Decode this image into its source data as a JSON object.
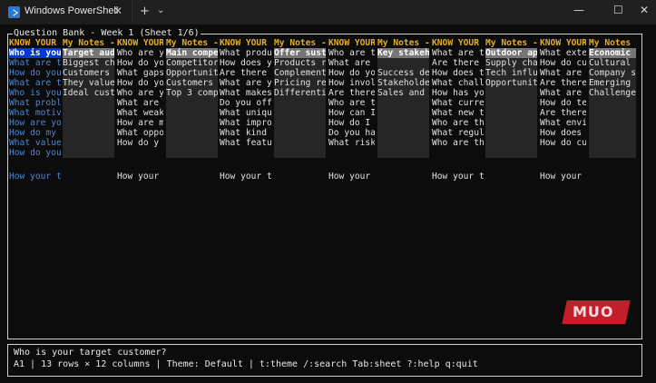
{
  "window": {
    "tab_title": "Windows PowerShell",
    "tab_close": "✕",
    "new_tab": "+",
    "dropdown": "⌄",
    "minimize": "—",
    "maximize": "☐",
    "close": "✕"
  },
  "panel": {
    "title": "Question Bank - Week 1 (Sheet 1/6)"
  },
  "sheet": {
    "headers": [
      "KNOW YOUR",
      "My Notes -",
      "KNOW YOUR",
      "My Notes -",
      "KNOW YOUR",
      "My Notes -",
      "KNOW YOUR",
      "My Notes -",
      "KNOW YOUR",
      "My Notes -",
      "KNOW YOUR",
      "My Notes -"
    ],
    "rows": [
      [
        "Who is you",
        "Target aud",
        "Who are y",
        "Main compe",
        "What produ",
        "Offer sust",
        "Who are t",
        "Key stakeh",
        "What are t",
        "Outdoor ap",
        "What exte",
        "Economic s"
      ],
      [
        "What are t",
        "Biggest ch",
        "How do yo",
        "Competitor",
        "How does y",
        "Products r",
        "What are",
        "",
        "Are there",
        "Supply cha",
        "How do cu",
        "Cultural t"
      ],
      [
        "How do you",
        "Customers",
        "What gaps",
        "Opportunit",
        "Are there",
        "Complement",
        "How do yo",
        "Success de",
        "How does t",
        "Tech influ",
        "What are",
        "Company st"
      ],
      [
        "What are t",
        "They value",
        "How do yo",
        "Customers",
        "What are y",
        "Pricing re",
        "How invol",
        "Stakeholde",
        "What chall",
        "Opportunit",
        "Are there",
        "Emerging m"
      ],
      [
        "Who is you",
        "Ideal cust",
        "Who are y",
        "Top 3 comp",
        "What makes",
        "Differenti",
        "Are there",
        "Sales and",
        "How has yo",
        "",
        "What are",
        "Challenges"
      ],
      [
        "What probl",
        "",
        "What are",
        "",
        "Do you off",
        "",
        "Who are t",
        "",
        "What curre",
        "",
        "How do te",
        ""
      ],
      [
        "What motiv",
        "",
        "What weak",
        "",
        "What uniqu",
        "",
        "How can I",
        "",
        "What new t",
        "",
        "Are there",
        ""
      ],
      [
        "How are yo",
        "",
        "How are m",
        "",
        "What impro",
        "",
        "How do I",
        "",
        "Who are th",
        "",
        "What envi",
        ""
      ],
      [
        "How do my",
        "",
        "What oppo",
        "",
        "What kind",
        "",
        "Do you ha",
        "",
        "What regul",
        "",
        "How does",
        ""
      ],
      [
        "What value",
        "",
        "How do y",
        "",
        "What featu",
        "",
        "What risk",
        "",
        "Who are th",
        "",
        "How do cu",
        ""
      ],
      [
        "How do you",
        "",
        "",
        "",
        "",
        "",
        "",
        "",
        "",
        "",
        "",
        ""
      ],
      [
        "",
        "",
        "",
        "",
        "",
        "",
        "",
        "",
        "",
        "",
        "",
        ""
      ],
      [
        "How your t",
        "",
        "How your",
        "",
        "How your t",
        "",
        "How your",
        "",
        "How your t",
        "",
        "How your",
        ""
      ]
    ]
  },
  "status": {
    "cell_text": "Who is your target customer?",
    "info": "A1 | 13 rows × 12 columns | Theme: Default | t:theme /:search Tab:sheet ?:help q:quit"
  },
  "watermark": {
    "text": "MUO"
  }
}
